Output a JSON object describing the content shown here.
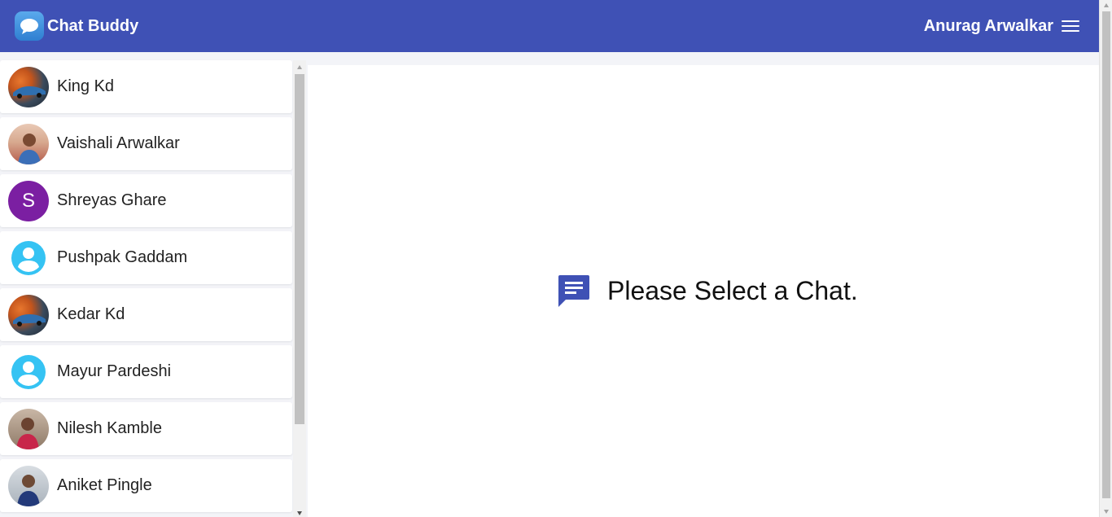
{
  "app": {
    "title": "Chat Buddy",
    "brand_icon": "chat-bubble-icon",
    "accent": "#3f51b5"
  },
  "user": {
    "name": "Anurag Arwalkar",
    "menu_icon": "hamburger-menu-icon"
  },
  "chats": [
    {
      "name": "King Kd",
      "avatar": "photo-car"
    },
    {
      "name": "Vaishali Arwalkar",
      "avatar": "photo-person"
    },
    {
      "name": "Shreyas Ghare",
      "avatar": "letter",
      "initial": "S",
      "color": "#7b1fa2"
    },
    {
      "name": "Pushpak Gaddam",
      "avatar": "default-person-icon"
    },
    {
      "name": "Kedar Kd",
      "avatar": "photo-car"
    },
    {
      "name": "Mayur Pardeshi",
      "avatar": "default-person-icon"
    },
    {
      "name": "Nilesh Kamble",
      "avatar": "photo-person"
    },
    {
      "name": "Aniket Pingle",
      "avatar": "photo-person"
    }
  ],
  "main": {
    "empty_message": "Please Select a Chat.",
    "icon": "chat-message-icon"
  }
}
